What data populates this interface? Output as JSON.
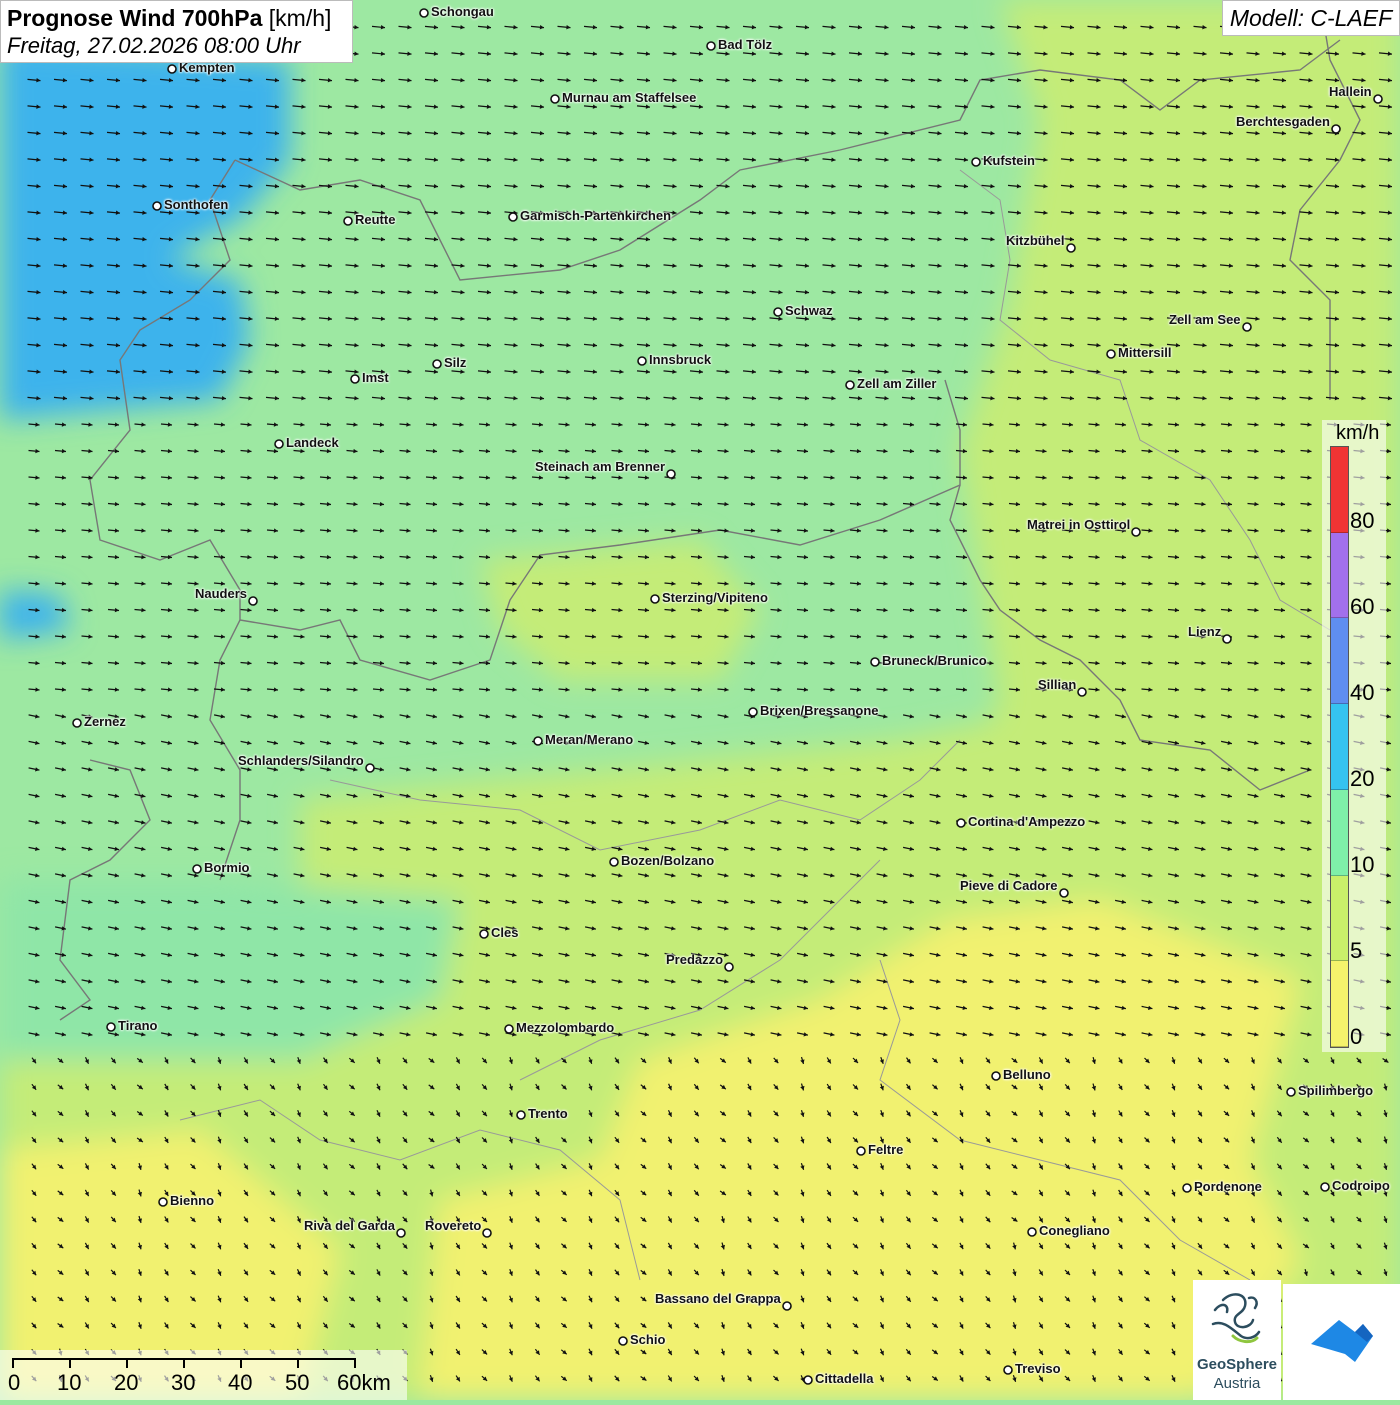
{
  "title": {
    "bold": "Prognose Wind 700hPa",
    "unit": "[km/h]",
    "date": "Freitag, 27.02.2026 08:00 Uhr"
  },
  "model": "Modell: C-LAEF",
  "legend": {
    "unit": "km/h",
    "labels": [
      "80",
      "60",
      "40",
      "20",
      "10",
      "5",
      "0"
    ],
    "colors": [
      "#f03434",
      "#a270ec",
      "#5f8ef0",
      "#35c3f0",
      "#7ff0a9",
      "#c9f06a",
      "#f5f36c"
    ]
  },
  "scalebar": {
    "labels": [
      "0",
      "10",
      "20",
      "30",
      "40",
      "50",
      "60km"
    ]
  },
  "logo": {
    "name": "GeoSphere",
    "sub": "Austria"
  },
  "cities": [
    {
      "name": "Schongau",
      "label_side": "right"
    },
    {
      "name": "Bad Tölz",
      "label_side": "right"
    },
    {
      "name": "Kempten",
      "label_side": "right"
    },
    {
      "name": "Murnau am Staffelsee",
      "label_side": "right"
    },
    {
      "name": "Hallein",
      "label_side": "left"
    },
    {
      "name": "Berchtesgaden",
      "label_side": "left"
    },
    {
      "name": "Kufstein",
      "label_side": "right"
    },
    {
      "name": "Sonthofen",
      "label_side": "right"
    },
    {
      "name": "Reutte",
      "label_side": "right"
    },
    {
      "name": "Garmisch-Partenkirchen",
      "label_side": "right"
    },
    {
      "name": "Kitzbühel",
      "label_side": "left"
    },
    {
      "name": "Schwaz",
      "label_side": "right"
    },
    {
      "name": "Zell am See",
      "label_side": "left"
    },
    {
      "name": "Innsbruck",
      "label_side": "right"
    },
    {
      "name": "Mittersill",
      "label_side": "right"
    },
    {
      "name": "Silz",
      "label_side": "right"
    },
    {
      "name": "Imst",
      "label_side": "right"
    },
    {
      "name": "Zell am Ziller",
      "label_side": "right"
    },
    {
      "name": "Landeck",
      "label_side": "right"
    },
    {
      "name": "Steinach am Brenner",
      "label_side": "left"
    },
    {
      "name": "Matrei in Osttirol",
      "label_side": "left"
    },
    {
      "name": "Nauders",
      "label_side": "left"
    },
    {
      "name": "Sterzing/Vipiteno",
      "label_side": "right"
    },
    {
      "name": "Lienz",
      "label_side": "left"
    },
    {
      "name": "Bruneck/Brunico",
      "label_side": "right"
    },
    {
      "name": "Sillian",
      "label_side": "left"
    },
    {
      "name": "Zernez",
      "label_side": "right"
    },
    {
      "name": "Brixen/Bressanone",
      "label_side": "right"
    },
    {
      "name": "Meran/Merano",
      "label_side": "right"
    },
    {
      "name": "Schlanders/Silandro",
      "label_side": "left"
    },
    {
      "name": "Cortina d'Ampezzo",
      "label_side": "right"
    },
    {
      "name": "Bozen/Bolzano",
      "label_side": "right"
    },
    {
      "name": "Bormio",
      "label_side": "right"
    },
    {
      "name": "Pieve di Cadore",
      "label_side": "left"
    },
    {
      "name": "Cles",
      "label_side": "right"
    },
    {
      "name": "Predazzo",
      "label_side": "left"
    },
    {
      "name": "Tirano",
      "label_side": "right"
    },
    {
      "name": "Mezzolombardo",
      "label_side": "right"
    },
    {
      "name": "Belluno",
      "label_side": "right"
    },
    {
      "name": "Spilimbergo",
      "label_side": "right"
    },
    {
      "name": "Trento",
      "label_side": "right"
    },
    {
      "name": "Feltre",
      "label_side": "right"
    },
    {
      "name": "Pordenone",
      "label_side": "right"
    },
    {
      "name": "Codroipo",
      "label_side": "right"
    },
    {
      "name": "Bienno",
      "label_side": "right"
    },
    {
      "name": "Riva del Garda",
      "label_side": "left"
    },
    {
      "name": "Rovereto",
      "label_side": "left"
    },
    {
      "name": "Conegliano",
      "label_side": "right"
    },
    {
      "name": "Bassano del Grappa",
      "label_side": "left"
    },
    {
      "name": "Schio",
      "label_side": "right"
    },
    {
      "name": "Treviso",
      "label_side": "right"
    },
    {
      "name": "Cittadella",
      "label_side": "right"
    }
  ]
}
